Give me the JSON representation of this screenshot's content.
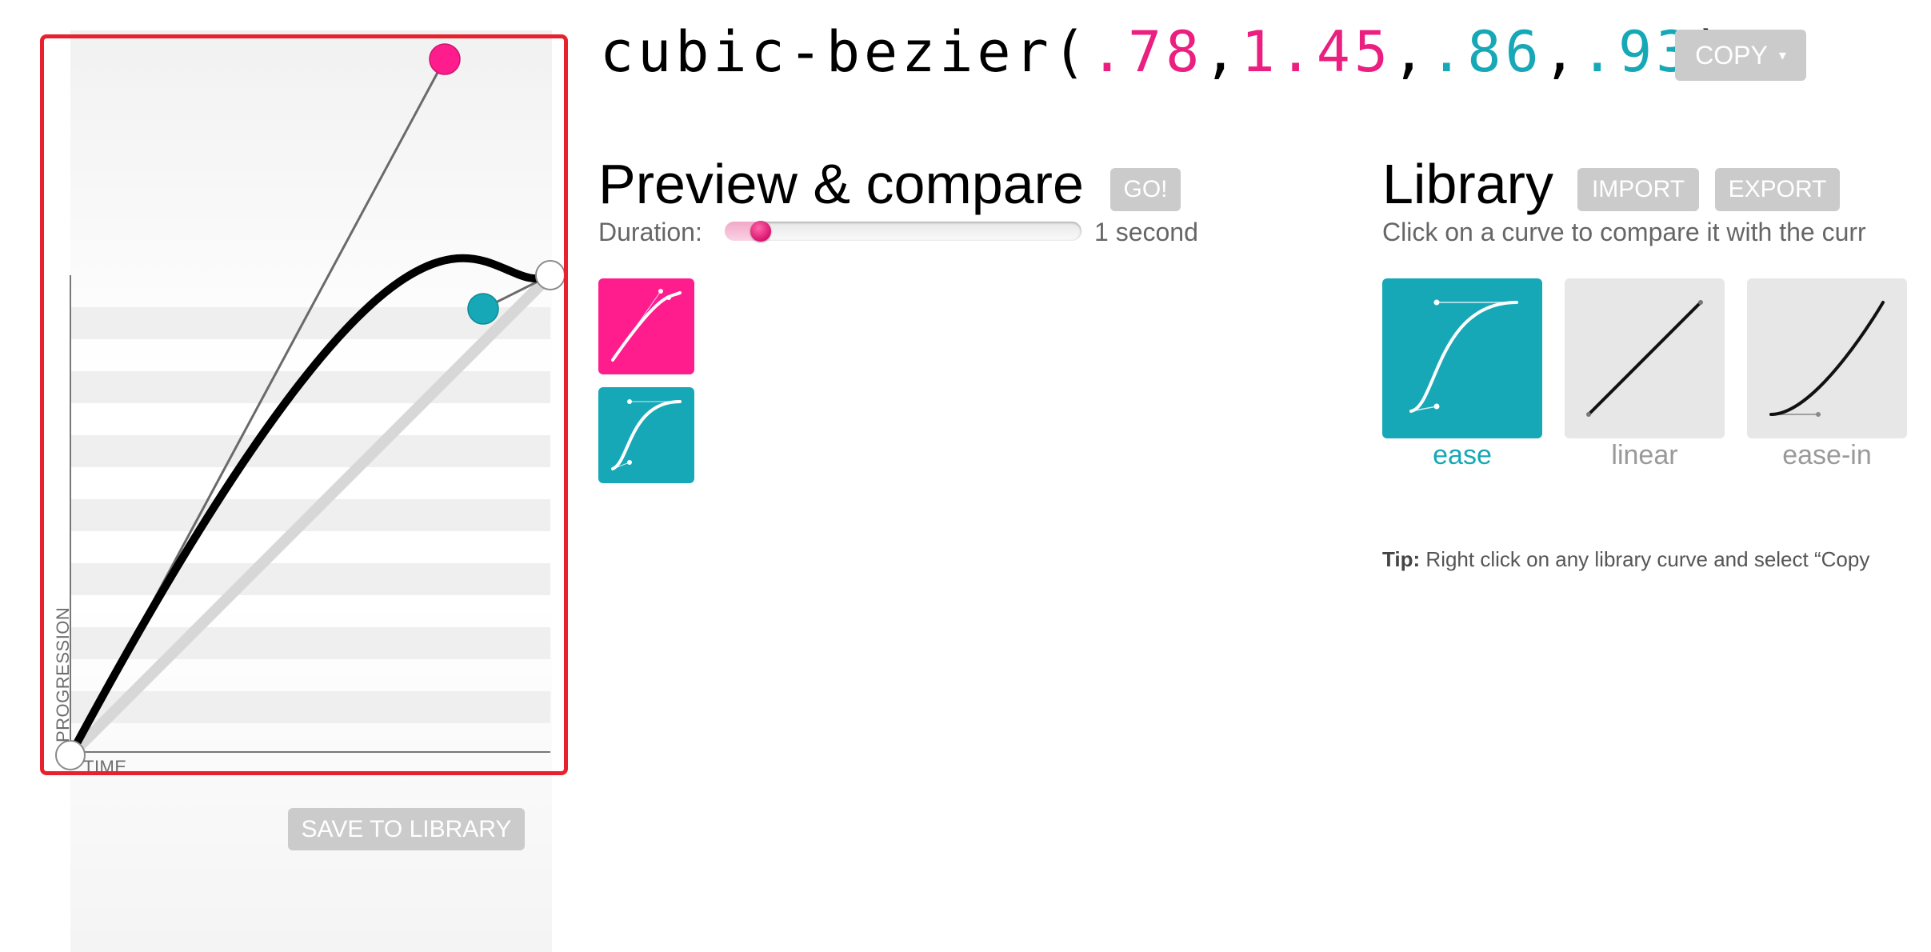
{
  "editor": {
    "axis_x_label": "TIME",
    "axis_y_label": "PROGRESSION",
    "save_button_label": "SAVE TO LIBRARY",
    "curve": {
      "p1": [
        0.78,
        1.45
      ],
      "p2": [
        0.86,
        0.93
      ]
    },
    "colors": {
      "p1_handle": "#ff1c8d",
      "p2_handle": "#16a8b6",
      "frame": "#e8212d"
    }
  },
  "header": {
    "prefix": "cubic-bezier(",
    "x1": ".78",
    "y1": "1.45",
    "x2": ".86",
    "y2": ".93",
    "comma": ",",
    "suffix": ")",
    "copy_label": "COPY",
    "copy_caret": "▾"
  },
  "preview": {
    "title": "Preview & compare",
    "go_label": "GO!",
    "duration_label": "Duration:",
    "duration_value": "1 second",
    "duration_fraction": 0.1
  },
  "library": {
    "title": "Library",
    "import_label": "IMPORT",
    "export_label": "EXPORT",
    "description": "Click on a curve to compare it with the curr",
    "items": [
      {
        "name": "ease",
        "selected": true,
        "curve": [
          0.25,
          0.1,
          0.25,
          1
        ]
      },
      {
        "name": "linear",
        "selected": false,
        "curve": [
          0,
          0,
          1,
          1
        ]
      },
      {
        "name": "ease-in",
        "selected": false,
        "curve": [
          0.42,
          0,
          1,
          1
        ]
      }
    ],
    "tip_label": "Tip:",
    "tip_text": "Right click on any library curve and select “Copy"
  },
  "theme": {
    "pink": "#ea1f7f",
    "teal": "#16a8b6",
    "button_gray": "#cbcbcb"
  }
}
